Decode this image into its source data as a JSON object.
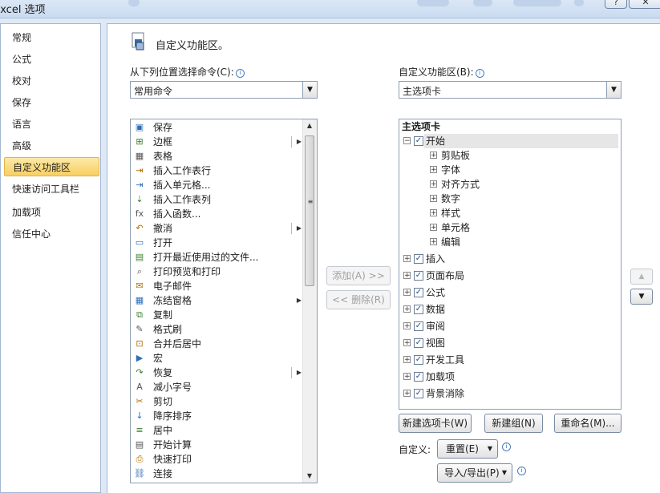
{
  "window": {
    "title": "Excel 选项",
    "help_label": "?",
    "close_label": "✕"
  },
  "nav": {
    "items": [
      {
        "label": "常规"
      },
      {
        "label": "公式"
      },
      {
        "label": "校对"
      },
      {
        "label": "保存"
      },
      {
        "label": "语言"
      },
      {
        "label": "高级"
      },
      {
        "label": "自定义功能区",
        "selected": true
      },
      {
        "label": "快速访问工具栏"
      },
      {
        "label": "加载项"
      },
      {
        "label": "信任中心"
      }
    ]
  },
  "header": {
    "title": "自定义功能区。"
  },
  "left": {
    "label": "从下列位置选择命令(C):",
    "combo_value": "常用命令",
    "commands": [
      {
        "label": "保存",
        "icon": "save-icon",
        "glyph": "▣"
      },
      {
        "label": "边框",
        "icon": "border-icon",
        "glyph": "⊞",
        "submenu": true,
        "sep": true
      },
      {
        "label": "表格",
        "icon": "table-icon",
        "glyph": "▦"
      },
      {
        "label": "插入工作表行",
        "icon": "insert-row-icon",
        "glyph": "⇥"
      },
      {
        "label": "插入单元格...",
        "icon": "insert-cell-icon",
        "glyph": "⇥"
      },
      {
        "label": "插入工作表列",
        "icon": "insert-column-icon",
        "glyph": "⇣"
      },
      {
        "label": "插入函数...",
        "icon": "function-icon",
        "glyph": "fx"
      },
      {
        "label": "撤消",
        "icon": "undo-icon",
        "glyph": "↶",
        "submenu": true,
        "sep": true
      },
      {
        "label": "打开",
        "icon": "open-folder-icon",
        "glyph": "▭"
      },
      {
        "label": "打开最近使用过的文件...",
        "icon": "recent-files-icon",
        "glyph": "▤"
      },
      {
        "label": "打印预览和打印",
        "icon": "print-preview-icon",
        "glyph": "⌕"
      },
      {
        "label": "电子邮件",
        "icon": "email-icon",
        "glyph": "✉"
      },
      {
        "label": "冻结窗格",
        "icon": "freeze-panes-icon",
        "glyph": "▦",
        "submenu": true
      },
      {
        "label": "复制",
        "icon": "copy-icon",
        "glyph": "⧉"
      },
      {
        "label": "格式刷",
        "icon": "format-painter-icon",
        "glyph": "✎"
      },
      {
        "label": "合并后居中",
        "icon": "merge-center-icon",
        "glyph": "⊡"
      },
      {
        "label": "宏",
        "icon": "macro-icon",
        "glyph": "▶"
      },
      {
        "label": "恢复",
        "icon": "redo-icon",
        "glyph": "↷",
        "submenu": true,
        "sep": true
      },
      {
        "label": "减小字号",
        "icon": "decrease-font-icon",
        "glyph": "A"
      },
      {
        "label": "剪切",
        "icon": "cut-icon",
        "glyph": "✂"
      },
      {
        "label": "降序排序",
        "icon": "sort-descending-icon",
        "glyph": "↓"
      },
      {
        "label": "居中",
        "icon": "center-align-icon",
        "glyph": "≡"
      },
      {
        "label": "开始计算",
        "icon": "calculate-icon",
        "glyph": "▤"
      },
      {
        "label": "快速打印",
        "icon": "quick-print-icon",
        "glyph": "⎙"
      },
      {
        "label": "连接",
        "icon": "connections-icon",
        "glyph": "⛓"
      }
    ]
  },
  "middle": {
    "add_label": "添加(A) >>",
    "remove_label": "<< 删除(R)"
  },
  "right": {
    "label": "自定义功能区(B):",
    "combo_value": "主选项卡",
    "tree_header": "主选项卡",
    "tabs": [
      {
        "label": "开始",
        "expanded": true,
        "checked": true,
        "groups": [
          "剪贴板",
          "字体",
          "对齐方式",
          "数字",
          "样式",
          "单元格",
          "编辑"
        ]
      },
      {
        "label": "插入",
        "checked": true
      },
      {
        "label": "页面布局",
        "checked": true
      },
      {
        "label": "公式",
        "checked": true
      },
      {
        "label": "数据",
        "checked": true
      },
      {
        "label": "审阅",
        "checked": true
      },
      {
        "label": "视图",
        "checked": true
      },
      {
        "label": "开发工具",
        "checked": true
      },
      {
        "label": "加载项",
        "checked": true
      },
      {
        "label": "背景消除",
        "checked": true
      }
    ],
    "new_tab_label": "新建选项卡(W)",
    "new_group_label": "新建组(N)",
    "rename_label": "重命名(M)...",
    "customize_label": "自定义:",
    "reset_label": "重置(E)",
    "import_export_label": "导入/导出(P)"
  }
}
